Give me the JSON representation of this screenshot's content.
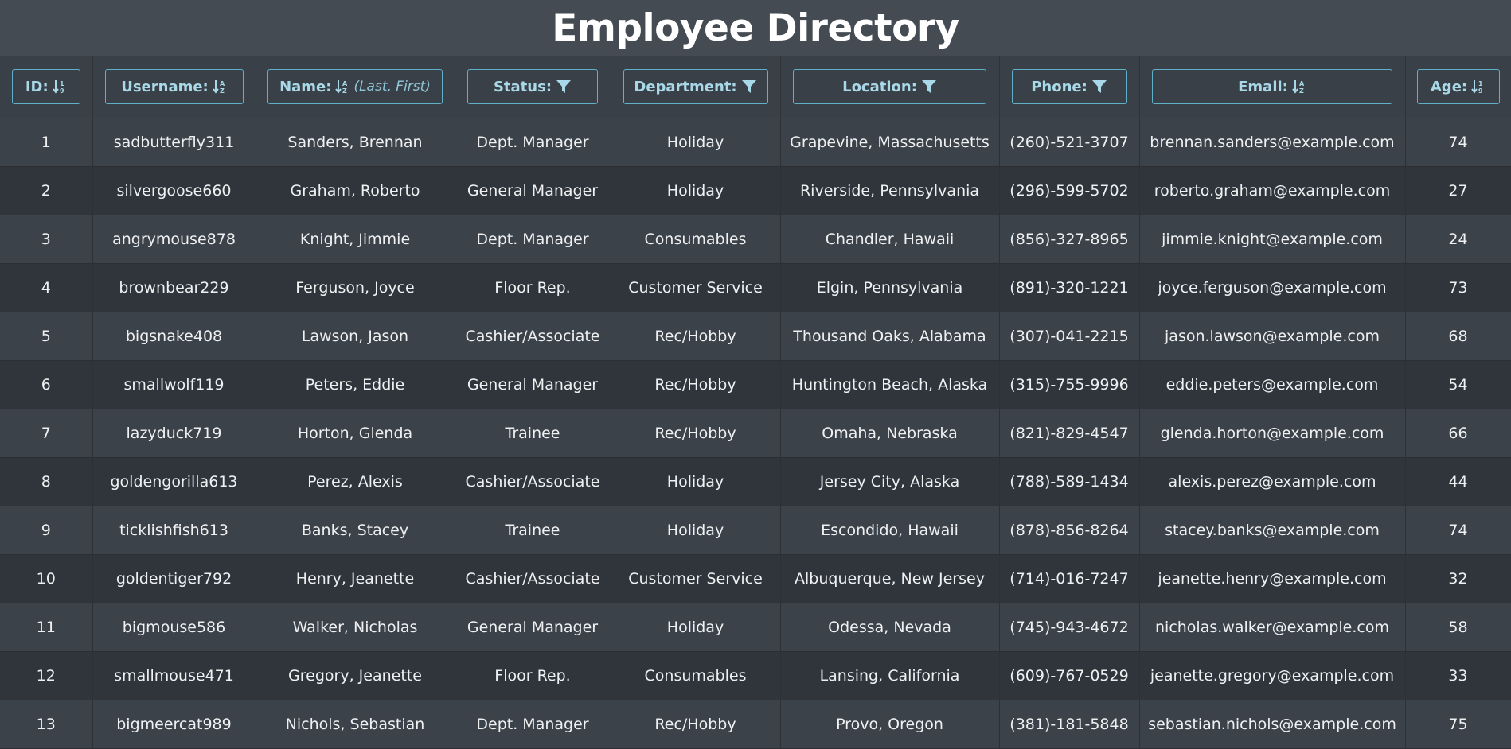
{
  "page": {
    "title": "Employee Directory"
  },
  "columns": [
    {
      "key": "id",
      "label": "ID:",
      "icon": "sort-icon",
      "sub": ""
    },
    {
      "key": "username",
      "label": "Username:",
      "icon": "sort-alpha-icon",
      "sub": ""
    },
    {
      "key": "name",
      "label": "Name:",
      "icon": "sort-alpha-icon",
      "sub": "(Last, First)"
    },
    {
      "key": "status",
      "label": "Status:",
      "icon": "filter-icon",
      "sub": ""
    },
    {
      "key": "department",
      "label": "Department:",
      "icon": "filter-icon",
      "sub": ""
    },
    {
      "key": "location",
      "label": "Location:",
      "icon": "filter-icon",
      "sub": ""
    },
    {
      "key": "phone",
      "label": "Phone:",
      "icon": "filter-icon",
      "sub": ""
    },
    {
      "key": "email",
      "label": "Email:",
      "icon": "sort-alpha-icon",
      "sub": ""
    },
    {
      "key": "age",
      "label": "Age:",
      "icon": "sort-icon",
      "sub": ""
    }
  ],
  "rows": [
    [
      "1",
      "sadbutterfly311",
      "Sanders, Brennan",
      "Dept. Manager",
      "Holiday",
      "Grapevine, Massachusetts",
      "(260)-521-3707",
      "brennan.sanders@example.com",
      "74"
    ],
    [
      "2",
      "silvergoose660",
      "Graham, Roberto",
      "General Manager",
      "Holiday",
      "Riverside, Pennsylvania",
      "(296)-599-5702",
      "roberto.graham@example.com",
      "27"
    ],
    [
      "3",
      "angrymouse878",
      "Knight, Jimmie",
      "Dept. Manager",
      "Consumables",
      "Chandler, Hawaii",
      "(856)-327-8965",
      "jimmie.knight@example.com",
      "24"
    ],
    [
      "4",
      "brownbear229",
      "Ferguson, Joyce",
      "Floor Rep.",
      "Customer Service",
      "Elgin, Pennsylvania",
      "(891)-320-1221",
      "joyce.ferguson@example.com",
      "73"
    ],
    [
      "5",
      "bigsnake408",
      "Lawson, Jason",
      "Cashier/Associate",
      "Rec/Hobby",
      "Thousand Oaks, Alabama",
      "(307)-041-2215",
      "jason.lawson@example.com",
      "68"
    ],
    [
      "6",
      "smallwolf119",
      "Peters, Eddie",
      "General Manager",
      "Rec/Hobby",
      "Huntington Beach, Alaska",
      "(315)-755-9996",
      "eddie.peters@example.com",
      "54"
    ],
    [
      "7",
      "lazyduck719",
      "Horton, Glenda",
      "Trainee",
      "Rec/Hobby",
      "Omaha, Nebraska",
      "(821)-829-4547",
      "glenda.horton@example.com",
      "66"
    ],
    [
      "8",
      "goldengorilla613",
      "Perez, Alexis",
      "Cashier/Associate",
      "Holiday",
      "Jersey City, Alaska",
      "(788)-589-1434",
      "alexis.perez@example.com",
      "44"
    ],
    [
      "9",
      "ticklishfish613",
      "Banks, Stacey",
      "Trainee",
      "Holiday",
      "Escondido, Hawaii",
      "(878)-856-8264",
      "stacey.banks@example.com",
      "74"
    ],
    [
      "10",
      "goldentiger792",
      "Henry, Jeanette",
      "Cashier/Associate",
      "Customer Service",
      "Albuquerque, New Jersey",
      "(714)-016-7247",
      "jeanette.henry@example.com",
      "32"
    ],
    [
      "11",
      "bigmouse586",
      "Walker, Nicholas",
      "General Manager",
      "Holiday",
      "Odessa, Nevada",
      "(745)-943-4672",
      "nicholas.walker@example.com",
      "58"
    ],
    [
      "12",
      "smallmouse471",
      "Gregory, Jeanette",
      "Floor Rep.",
      "Consumables",
      "Lansing, California",
      "(609)-767-0529",
      "jeanette.gregory@example.com",
      "33"
    ],
    [
      "13",
      "bigmeercat989",
      "Nichols, Sebastian",
      "Dept. Manager",
      "Rec/Hobby",
      "Provo, Oregon",
      "(381)-181-5848",
      "sebastian.nichols@example.com",
      "75"
    ]
  ]
}
